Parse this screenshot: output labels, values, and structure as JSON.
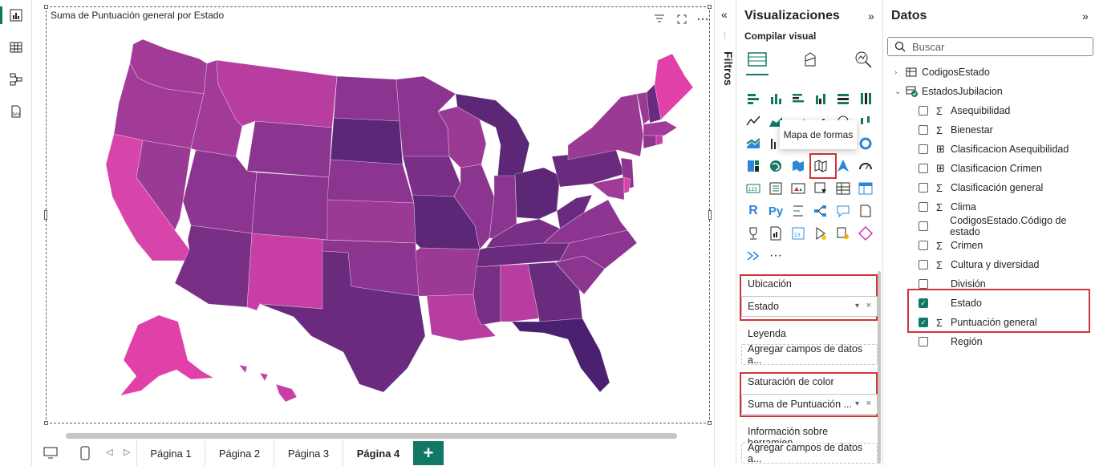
{
  "visual": {
    "title": "Suma de Puntuación general por Estado",
    "map_colors": {
      "light": "#e040a8",
      "mid": "#a23b97",
      "dark": "#5c2777",
      "darkest": "#4a2070"
    }
  },
  "page_tabs": [
    "Página 1",
    "Página 2",
    "Página 3",
    "Página 4"
  ],
  "active_tab": "Página 4",
  "add_tab_label": "+",
  "filters": {
    "label": "Filtros"
  },
  "visualizations": {
    "title": "Visualizaciones",
    "collapse_glyph": "»",
    "build_label": "Compilar visual",
    "tooltip": "Mapa de formas",
    "more_label": "···",
    "wells": {
      "ubicacion": {
        "label": "Ubicación",
        "value": "Estado"
      },
      "leyenda": {
        "label": "Leyenda",
        "value": "Agregar campos de datos a..."
      },
      "saturacion": {
        "label": "Saturación de color",
        "value": "Suma de Puntuación ..."
      },
      "info": {
        "label": "Información sobre herramien...",
        "value": "Agregar campos de datos a..."
      }
    }
  },
  "data_pane": {
    "title": "Datos",
    "collapse_glyph": "»",
    "search_placeholder": "Buscar",
    "tables": [
      {
        "name": "CodigosEstado",
        "expanded": false
      },
      {
        "name": "EstadosJubilacion",
        "expanded": true
      }
    ],
    "fields": [
      {
        "name": "Asequibilidad",
        "icon": "Σ",
        "checked": false
      },
      {
        "name": "Bienestar",
        "icon": "Σ",
        "checked": false
      },
      {
        "name": "Clasificacion Asequibilidad",
        "icon": "calc",
        "checked": false
      },
      {
        "name": "Clasificacion Crimen",
        "icon": "calc",
        "checked": false
      },
      {
        "name": "Clasificación general",
        "icon": "Σ",
        "checked": false
      },
      {
        "name": "Clima",
        "icon": "Σ",
        "checked": false
      },
      {
        "name": "CodigosEstado.Código de estado",
        "icon": "",
        "checked": false
      },
      {
        "name": "Crimen",
        "icon": "Σ",
        "checked": false
      },
      {
        "name": "Cultura y diversidad",
        "icon": "Σ",
        "checked": false
      },
      {
        "name": "División",
        "icon": "",
        "checked": false
      },
      {
        "name": "Estado",
        "icon": "",
        "checked": true
      },
      {
        "name": "Puntuación general",
        "icon": "Σ",
        "checked": true
      },
      {
        "name": "Región",
        "icon": "",
        "checked": false
      }
    ]
  }
}
